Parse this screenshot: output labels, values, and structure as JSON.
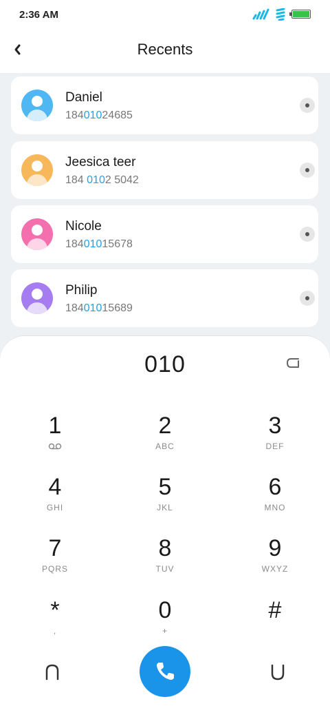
{
  "status": {
    "time": "2:36 AM"
  },
  "header": {
    "title": "Recents"
  },
  "contacts": [
    {
      "name": "Daniel",
      "num_pre": "184",
      "num_hl": "010",
      "num_post": "24685",
      "avatar_color": "#4fb8f2",
      "avatar_body": "#d6eefb"
    },
    {
      "name": "Jeesica teer",
      "num_pre": "184 ",
      "num_hl": "010",
      "num_post": "2 5042",
      "avatar_color": "#f7b85c",
      "avatar_body": "#fde6c7"
    },
    {
      "name": "Nicole",
      "num_pre": "184",
      "num_hl": "010",
      "num_post": "15678",
      "avatar_color": "#f36fae",
      "avatar_body": "#fcd5e8"
    },
    {
      "name": "Philip",
      "num_pre": "184",
      "num_hl": "010",
      "num_post": "15689",
      "avatar_color": "#a57df0",
      "avatar_body": "#e6dbfb"
    }
  ],
  "dialer": {
    "entered": "010",
    "keys": [
      {
        "digit": "1",
        "letters": ""
      },
      {
        "digit": "2",
        "letters": "ABC"
      },
      {
        "digit": "3",
        "letters": "DEF"
      },
      {
        "digit": "4",
        "letters": "GHI"
      },
      {
        "digit": "5",
        "letters": "JKL"
      },
      {
        "digit": "6",
        "letters": "MNO"
      },
      {
        "digit": "7",
        "letters": "PQRS"
      },
      {
        "digit": "8",
        "letters": "TUV"
      },
      {
        "digit": "9",
        "letters": "WXYZ"
      },
      {
        "digit": "*",
        "letters": ","
      },
      {
        "digit": "0",
        "letters": "+"
      },
      {
        "digit": "#",
        "letters": ""
      }
    ]
  },
  "icons": {
    "back": "chevron-left-icon",
    "delete": "backspace-icon",
    "voicemail": "voicemail-icon",
    "call": "phone-icon",
    "sim_left": "sim-switch-left-icon",
    "sim_right": "sim-switch-right-icon"
  },
  "colors": {
    "accent": "#1a94e8",
    "highlight": "#1da1f2"
  }
}
